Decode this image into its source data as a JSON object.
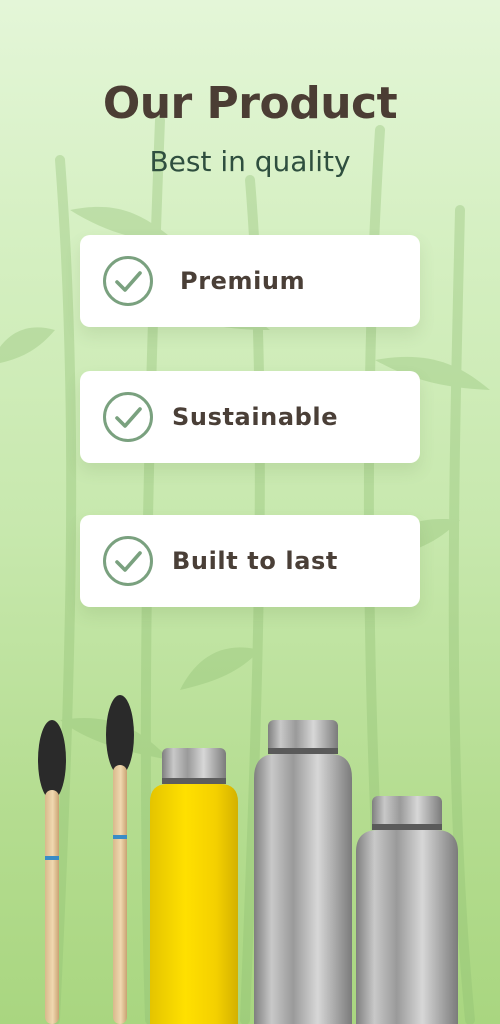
{
  "header": {
    "title": "Our Product",
    "subtitle": "Best in quality"
  },
  "features": [
    {
      "label": "Premium",
      "icon": "check-circle-icon"
    },
    {
      "label": "Sustainable",
      "icon": "check-circle-icon"
    },
    {
      "label": "Built to last",
      "icon": "check-circle-icon"
    }
  ],
  "illustration": {
    "items": [
      "bamboo-toothbrush",
      "bamboo-toothbrush",
      "yellow-steel-bottle",
      "steel-bottle",
      "steel-bottle"
    ]
  },
  "colors": {
    "background_top": "#e4f6d8",
    "background_bottom": "#a9d680",
    "title": "#4b3d34",
    "subtitle": "#2f4f3f",
    "check": "#7aa17f",
    "card": "#ffffff"
  }
}
